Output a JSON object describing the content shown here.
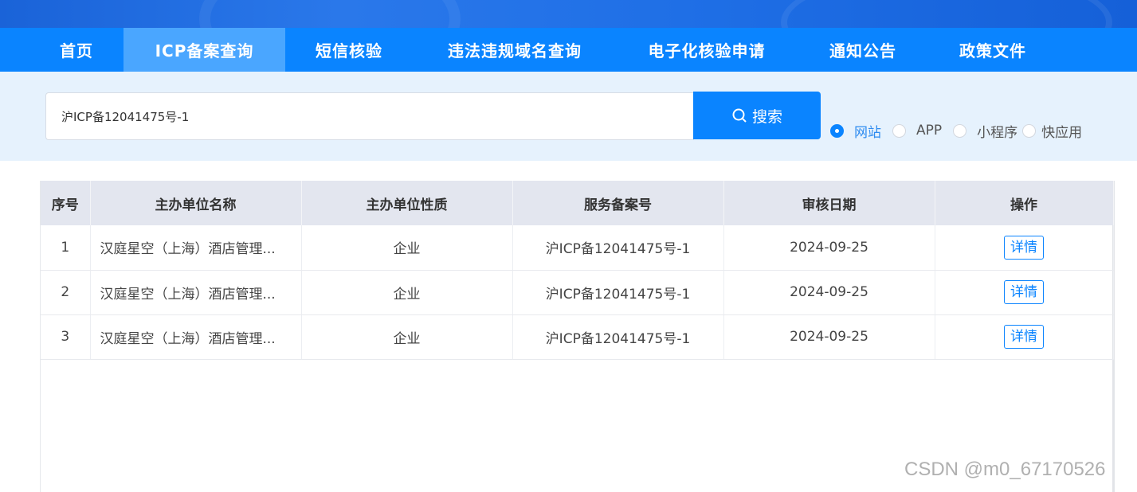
{
  "nav": {
    "items": [
      {
        "label": "首页",
        "active": false
      },
      {
        "label": "ICP备案查询",
        "active": true
      },
      {
        "label": "短信核验",
        "active": false
      },
      {
        "label": "违法违规域名查询",
        "active": false
      },
      {
        "label": "电子化核验申请",
        "active": false
      },
      {
        "label": "通知公告",
        "active": false
      },
      {
        "label": "政策文件",
        "active": false
      }
    ]
  },
  "search": {
    "value": "沪ICP备12041475号-1",
    "button_label": "搜索",
    "radios": [
      {
        "label": "网站",
        "checked": true
      },
      {
        "label": "APP",
        "checked": false
      },
      {
        "label": "小程序",
        "checked": false
      },
      {
        "label": "快应用",
        "checked": false
      }
    ]
  },
  "table": {
    "headers": [
      "序号",
      "主办单位名称",
      "主办单位性质",
      "服务备案号",
      "审核日期",
      "操作"
    ],
    "rows": [
      {
        "index": "1",
        "name": "汉庭星空（上海）酒店管理...",
        "nature": "企业",
        "record": "沪ICP备12041475号-1",
        "date": "2024-09-25",
        "action": "详情"
      },
      {
        "index": "2",
        "name": "汉庭星空（上海）酒店管理...",
        "nature": "企业",
        "record": "沪ICP备12041475号-1",
        "date": "2024-09-25",
        "action": "详情"
      },
      {
        "index": "3",
        "name": "汉庭星空（上海）酒店管理...",
        "nature": "企业",
        "record": "沪ICP备12041475号-1",
        "date": "2024-09-25",
        "action": "详情"
      }
    ]
  },
  "watermark": "CSDN @m0_67170526",
  "colors": {
    "primary": "#0a84ff",
    "nav_active": "#4aa6ff",
    "search_band": "#e6f2fd",
    "table_header": "#e3e6ef"
  },
  "icons": {
    "search": "search-icon"
  }
}
